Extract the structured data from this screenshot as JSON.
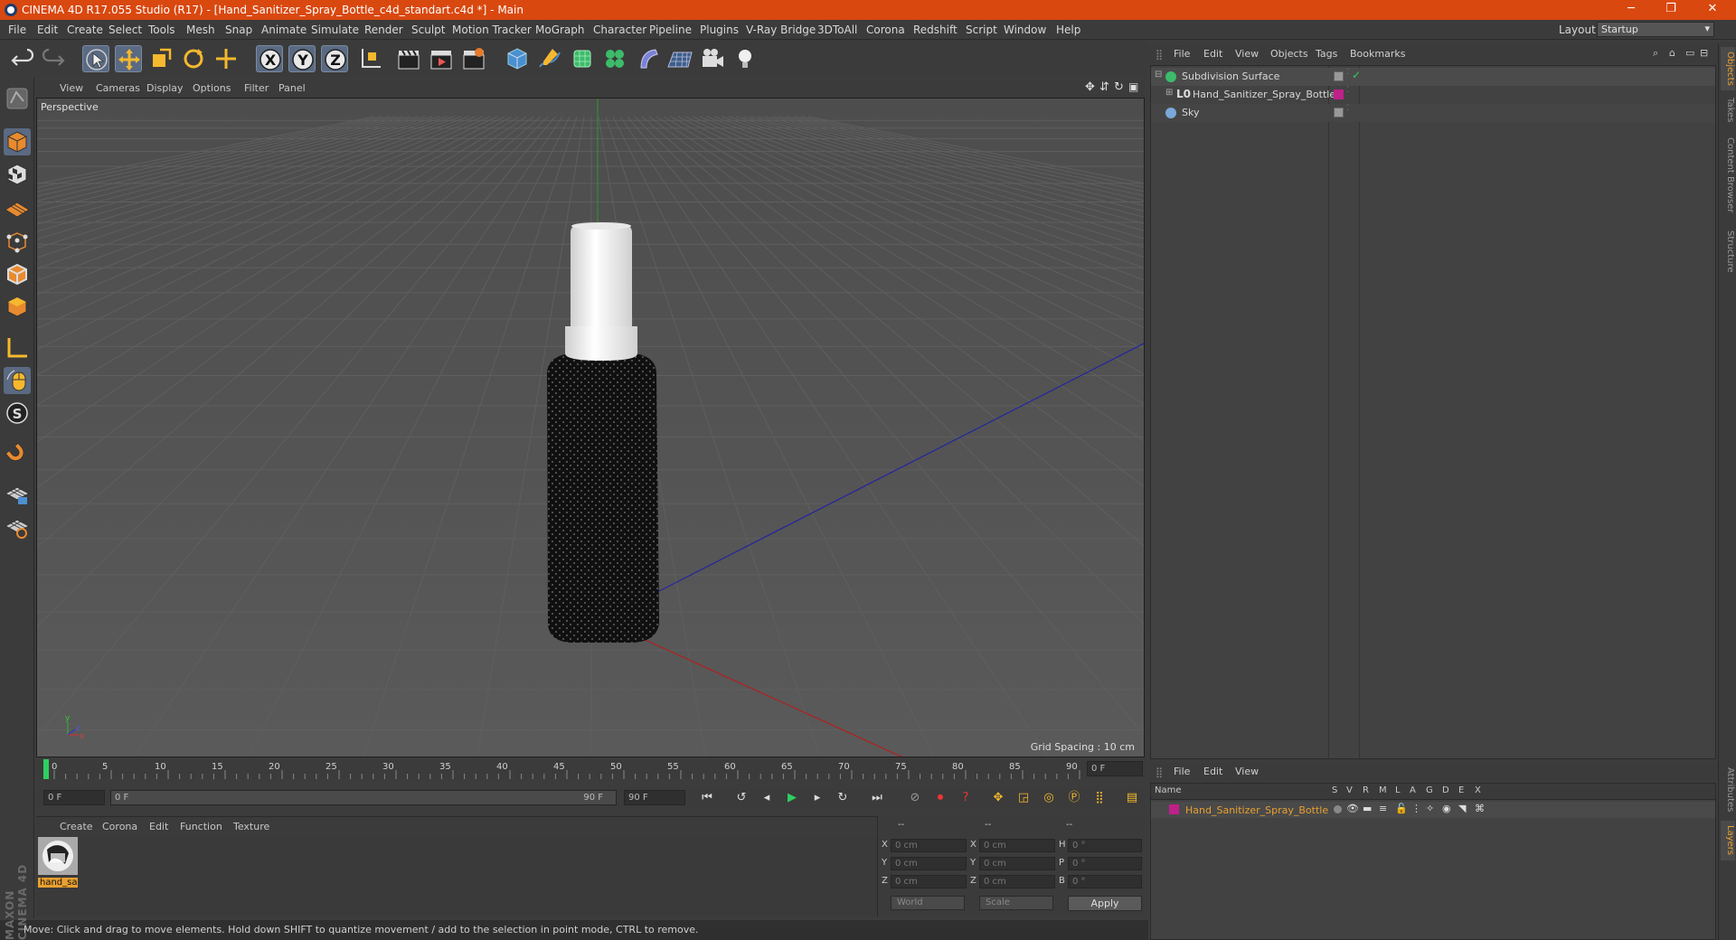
{
  "window": {
    "title": "CINEMA 4D R17.055 Studio (R17) - [Hand_Sanitizer_Spray_Bottle_c4d_standart.c4d *] - Main",
    "minimize": "─",
    "maximize": "❐",
    "close": "✕"
  },
  "menu": {
    "items": [
      "File",
      "Edit",
      "Create",
      "Select",
      "Tools",
      "Mesh",
      "Snap",
      "Animate",
      "Simulate",
      "Render",
      "Sculpt",
      "Motion Tracker",
      "MoGraph",
      "Character",
      "Pipeline",
      "Plugins",
      "V-Ray Bridge",
      "3DToAll",
      "Corona",
      "Redshift",
      "Script",
      "Window",
      "Help"
    ],
    "layout_label": "Layout:",
    "layout_value": "Startup"
  },
  "viewport": {
    "menu": [
      "View",
      "Cameras",
      "Display",
      "Options",
      "Filter",
      "Panel"
    ],
    "label": "Perspective",
    "grid_spacing": "Grid Spacing : 10 cm"
  },
  "timeline": {
    "ticks": [
      "0",
      "5",
      "10",
      "15",
      "20",
      "25",
      "30",
      "35",
      "40",
      "45",
      "50",
      "55",
      "60",
      "65",
      "70",
      "75",
      "80",
      "85",
      "90"
    ],
    "current_frame": "0 F",
    "start_field": "0 F",
    "range_start": "0 F",
    "range_end": "90 F",
    "end_field": "90 F"
  },
  "materials": {
    "menu": [
      "Create",
      "Corona",
      "Edit",
      "Function",
      "Texture"
    ],
    "items": [
      {
        "name": "hand_sa"
      }
    ]
  },
  "attributes": {
    "headers": [
      "--",
      "--",
      "--"
    ],
    "rows": [
      {
        "a": "X",
        "av": "0 cm",
        "b": "X",
        "bv": "0 cm",
        "c": "H",
        "cv": "0 °"
      },
      {
        "a": "Y",
        "av": "0 cm",
        "b": "Y",
        "bv": "0 cm",
        "c": "P",
        "cv": "0 °"
      },
      {
        "a": "Z",
        "av": "0 cm",
        "b": "Z",
        "bv": "0 cm",
        "c": "B",
        "cv": "0 °"
      }
    ],
    "coord_mode": "World",
    "scale_mode": "Scale",
    "apply_label": "Apply"
  },
  "object_manager": {
    "menu": [
      "File",
      "Edit",
      "View",
      "Objects",
      "Tags",
      "Bookmarks"
    ],
    "objects": [
      {
        "name": "Subdivision Surface"
      },
      {
        "name": "Hand_Sanitizer_Spray_Bottle"
      },
      {
        "name": "Sky"
      }
    ]
  },
  "layer_manager": {
    "menu": [
      "File",
      "Edit",
      "View"
    ],
    "columns": [
      "Name",
      "S",
      "V",
      "R",
      "M",
      "L",
      "A",
      "G",
      "D",
      "E",
      "X"
    ],
    "layers": [
      {
        "name": "Hand_Sanitizer_Spray_Bottle",
        "color": "#c0208a"
      }
    ]
  },
  "right_tabs": [
    "Objects",
    "Takes",
    "Content Browser",
    "Structure"
  ],
  "right_tabs_lower": [
    "Attributes",
    "Layers"
  ],
  "brand": "MAXON CINEMA 4D",
  "status": "Move: Click and drag to move elements. Hold down SHIFT to quantize movement / add to the selection in point mode, CTRL to remove."
}
